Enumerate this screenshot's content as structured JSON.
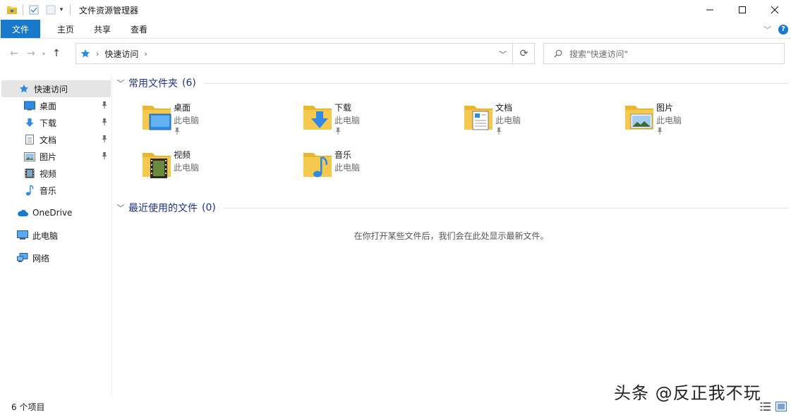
{
  "window": {
    "title": "文件资源管理器"
  },
  "ribbon": {
    "tabs": [
      "文件",
      "主页",
      "共享",
      "查看"
    ],
    "help_label": "?"
  },
  "address": {
    "breadcrumb": "快速访问",
    "search_placeholder": "搜索\"快速访问\""
  },
  "sidebar": {
    "items": [
      {
        "label": "快速访问",
        "icon": "star-icon",
        "selected": true
      },
      {
        "label": "桌面",
        "icon": "desktop-icon",
        "pinned": true
      },
      {
        "label": "下载",
        "icon": "download-icon",
        "pinned": true
      },
      {
        "label": "文档",
        "icon": "document-icon",
        "pinned": true
      },
      {
        "label": "图片",
        "icon": "picture-icon",
        "pinned": true
      },
      {
        "label": "视频",
        "icon": "video-icon"
      },
      {
        "label": "音乐",
        "icon": "music-icon"
      },
      {
        "label": "OneDrive",
        "icon": "cloud-icon"
      },
      {
        "label": "此电脑",
        "icon": "computer-icon"
      },
      {
        "label": "网络",
        "icon": "network-icon"
      }
    ]
  },
  "main": {
    "frequent": {
      "title": "常用文件夹",
      "count": "(6)",
      "folders": [
        {
          "name": "桌面",
          "location": "此电脑",
          "pinned": true
        },
        {
          "name": "下载",
          "location": "此电脑",
          "pinned": true
        },
        {
          "name": "文档",
          "location": "此电脑",
          "pinned": true
        },
        {
          "name": "图片",
          "location": "此电脑",
          "pinned": true
        },
        {
          "name": "视频",
          "location": "此电脑"
        },
        {
          "name": "音乐",
          "location": "此电脑"
        }
      ]
    },
    "recent": {
      "title": "最近使用的文件",
      "count": "(0)",
      "empty_message": "在你打开某些文件后，我们会在此处显示最新文件。"
    }
  },
  "status": {
    "item_count": "6 个项目"
  },
  "watermark": "头条 @反正我不玩",
  "colors": {
    "accent": "#1979ca",
    "group_title": "#1e3287",
    "folder": "#f5c94e"
  }
}
